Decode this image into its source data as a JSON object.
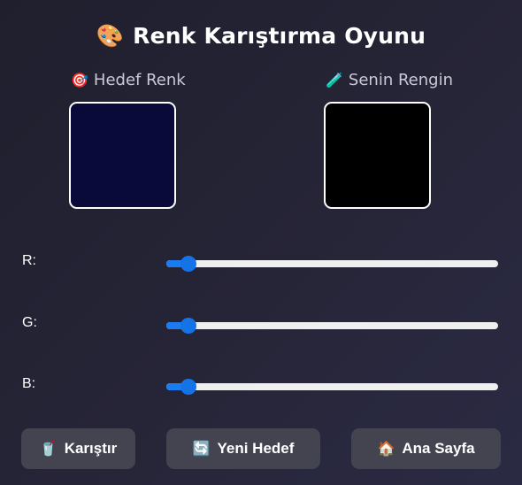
{
  "title": {
    "emoji": "🎨",
    "text": "Renk Karıştırma Oyunu"
  },
  "target": {
    "emoji": "🎯",
    "label": "Hedef Renk",
    "color": "#0a0a3a"
  },
  "yours": {
    "emoji": "🧪",
    "label": "Senin Rengin",
    "color": "#000000"
  },
  "sliders": [
    {
      "label": "R:",
      "value": 0,
      "max": 255
    },
    {
      "label": "G:",
      "value": 0,
      "max": 255
    },
    {
      "label": "B:",
      "value": 0,
      "max": 255
    }
  ],
  "buttons": {
    "mix": {
      "emoji": "🥤",
      "label": "Karıştır"
    },
    "new_target": {
      "emoji": "🔄",
      "label": "Yeni Hedef"
    },
    "home": {
      "emoji": "🏠",
      "label": "Ana Sayfa"
    }
  },
  "colors": {
    "accent": "#1473e6",
    "button_bg": "#444450",
    "background": "#262537"
  }
}
